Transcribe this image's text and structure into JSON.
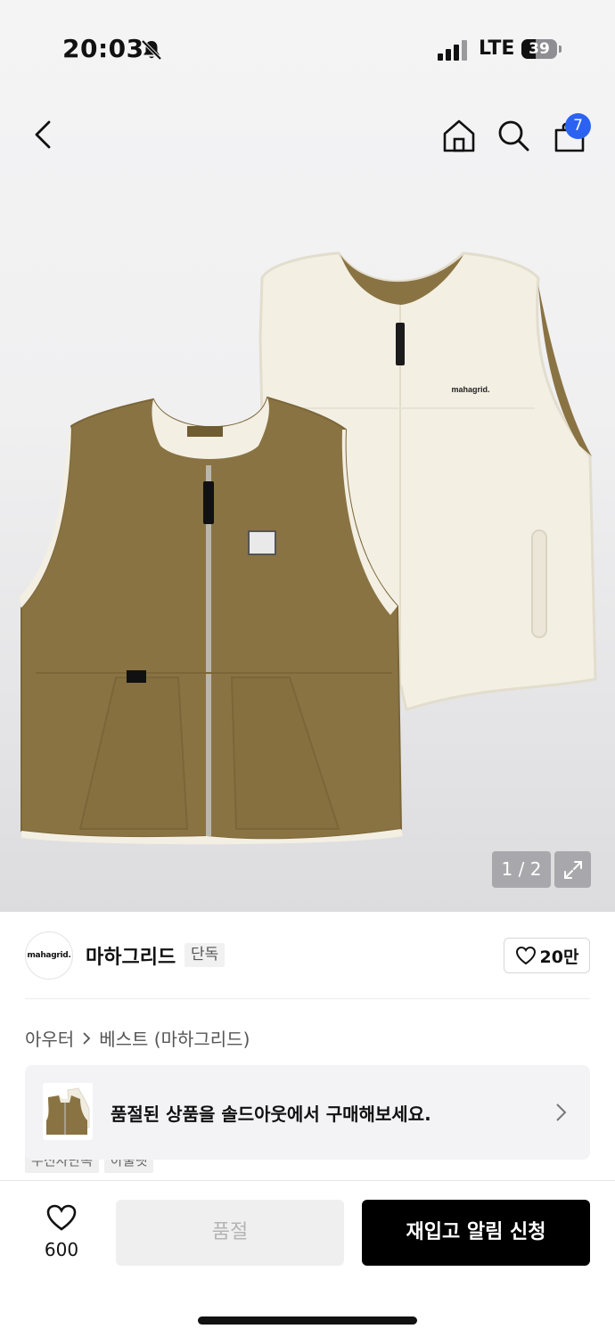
{
  "status_bar": {
    "time": "20:03",
    "network": "LTE",
    "battery": "39"
  },
  "header": {
    "cart_count": "7",
    "icons": [
      "back-icon",
      "home-icon",
      "search-icon",
      "cart-icon"
    ]
  },
  "gallery": {
    "counter": "1 / 2",
    "current_image": 1,
    "total_images": 2,
    "garment_logo": "mahagrid."
  },
  "brand": {
    "logo_text": "mahagrid.",
    "name": "마하그리드",
    "badge": "단독",
    "likes": "20만"
  },
  "breadcrumb": {
    "category": "아우터",
    "subcategory": "베스트 (마하그리드)"
  },
  "soldout_banner": {
    "text": "품절된 상품을 솔드아웃에서 구매해보세요."
  },
  "tags_peek": [
    "무신사단독",
    "아울렛"
  ],
  "bottom_bar": {
    "wish_count": "600",
    "soldout_label": "품절",
    "restock_label": "재입고 알림 신청"
  },
  "colors": {
    "accent_badge": "#2b62f2",
    "primary_button": "#000000",
    "disabled_button": "#efefef",
    "vest_olive": "#8a7343",
    "fleece_cream": "#f3efe3"
  }
}
